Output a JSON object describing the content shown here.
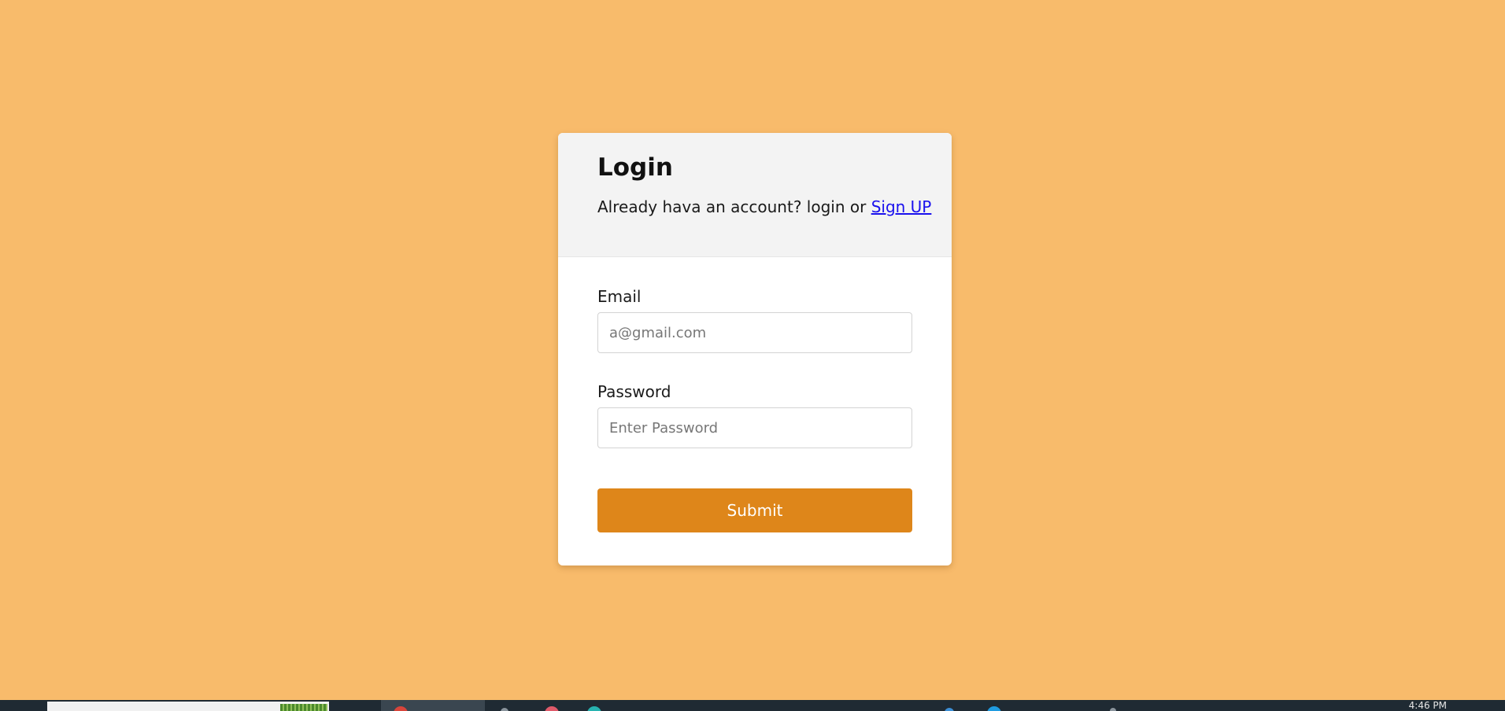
{
  "login": {
    "title": "Login",
    "subtitle_prefix": "Already hava an account? login or ",
    "signup_link": "Sign UP",
    "email_label": "Email",
    "email_placeholder": "a@gmail.com",
    "password_label": "Password",
    "password_placeholder": "Enter Password",
    "submit_label": "Submit"
  },
  "taskbar": {
    "clock": "4:46 PM"
  },
  "colors": {
    "background": "#f8bb6b",
    "card_header": "#f3f3f3",
    "accent": "#de861a",
    "link": "#1a10ee",
    "taskbar": "#1f2a33"
  }
}
